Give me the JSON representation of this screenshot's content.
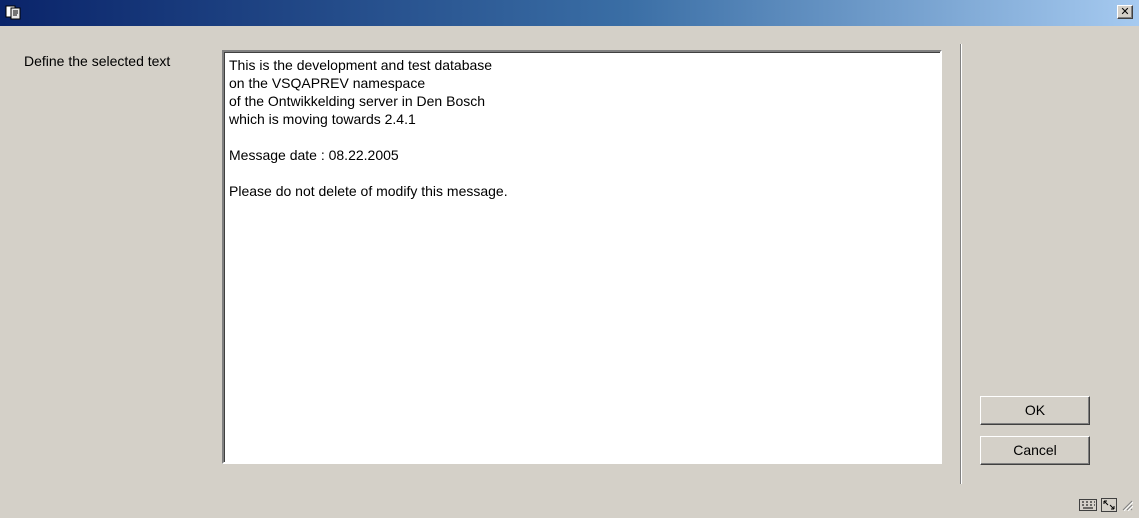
{
  "window": {
    "title": "",
    "close_symbol": "✕",
    "icons": {
      "app": "app-icon",
      "close": "close-icon"
    },
    "colors": {
      "titlebar_start": "#0a246a",
      "titlebar_end": "#a6caf0",
      "dialog_bg": "#d4d0c8"
    }
  },
  "form": {
    "label": "Define the selected text",
    "text_lines": [
      "This is the development and test database",
      "on the VSQAPREV namespace",
      "of the Ontwikkelding server in Den Bosch",
      "which is moving towards 2.4.1",
      "",
      "Message date : 08.22.2005",
      "",
      "Please do not delete of modify this message."
    ]
  },
  "buttons": {
    "ok_label": "OK",
    "cancel_label": "Cancel"
  },
  "status_bar": {
    "icons": [
      "keyboard-icon",
      "resize-window-icon",
      "resize-grip-icon"
    ]
  }
}
